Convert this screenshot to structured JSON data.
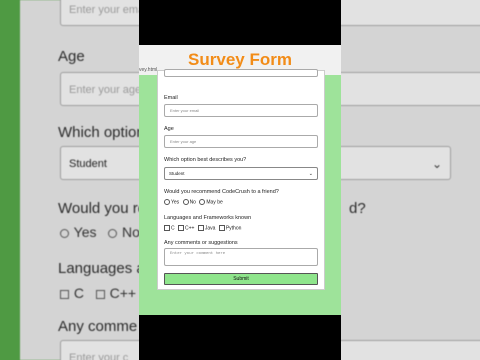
{
  "page": {
    "url_fragment": "vey.html",
    "headline": "Survey Form"
  },
  "form": {
    "email_label": "Email",
    "email_placeholder": "Enter your email",
    "age_label": "Age",
    "age_placeholder": "Enter your age",
    "role_label": "Which option best describes you?",
    "role_selected": "Student",
    "recommend_label": "Would you recommend CodeCrush to a friend?",
    "recommend_options": [
      "Yes",
      "No",
      "May be"
    ],
    "languages_label": "Languages and Frameworks known",
    "languages_options": [
      "C",
      "C++",
      "Java",
      "Python"
    ],
    "comments_label": "Any comments or suggestions",
    "comments_placeholder": "Enter your comment here",
    "submit_label": "Submit"
  },
  "background": {
    "name_placeholder": "Enter your email",
    "age_label": "Age",
    "age_placeholder": "Enter your age",
    "role_label_partial": "Which option",
    "role_selected": "Student",
    "recommend_label_partial": "Would you re",
    "recommend_suffix": "d?",
    "yes_label": "Yes",
    "no_label": "No",
    "languages_label_partial": "Languages a",
    "c_label": "C",
    "cpp_label": "C++",
    "comments_label_partial": "Any comme",
    "comments_placeholder": "Enter your c"
  },
  "colors": {
    "headline": "#f28c18",
    "page_bg": "#9ee39a",
    "submit_bg": "#8fe58c",
    "side_border": "#4f9a43"
  }
}
